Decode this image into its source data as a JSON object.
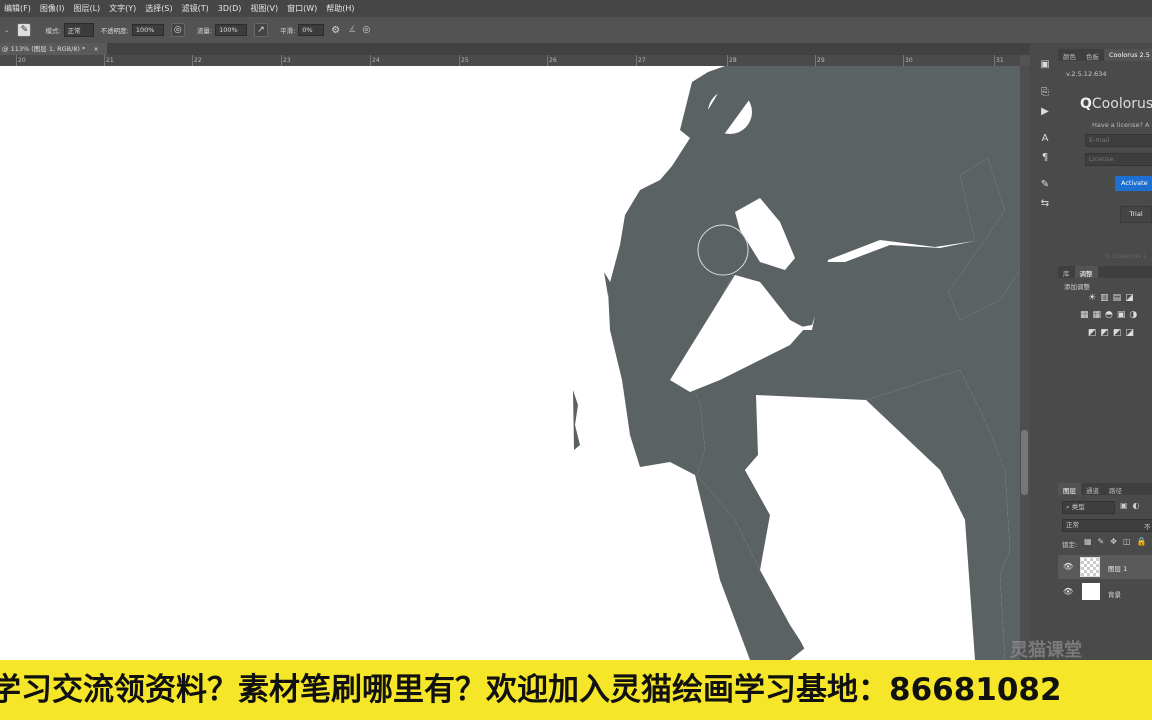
{
  "menu": [
    "编辑(F)",
    "图像(I)",
    "图层(L)",
    "文字(Y)",
    "选择(S)",
    "滤镜(T)",
    "3D(D)",
    "视图(V)",
    "窗口(W)",
    "帮助(H)"
  ],
  "options": {
    "mode_label": "模式:",
    "mode_value": "正常",
    "opacity_label": "不透明度:",
    "opacity_value": "100%",
    "flow_label": "流量:",
    "flow_value": "100%",
    "smoothing_label": "平滑:",
    "smoothing_value": "0%"
  },
  "document_tab": "@ 113% (图层 1, RGB/8) *",
  "ruler_labels": [
    "20",
    "21",
    "22",
    "23",
    "24",
    "25",
    "26",
    "27",
    "28",
    "29",
    "30",
    "31"
  ],
  "coolorus": {
    "tabs": [
      "颜色",
      "色板",
      "Coolorus 2.5"
    ],
    "version": "v.2.5.12.634",
    "logo": "Coolorus",
    "license_question": "Have a license? A",
    "email_placeholder": "E-mail",
    "license_placeholder": "License",
    "activate": "Activate",
    "trial": "Trial",
    "copyright": "© Coolorus L"
  },
  "adjustments": {
    "tabs": [
      "库",
      "调整"
    ],
    "title": "添加调整"
  },
  "layers": {
    "tabs": [
      "图层",
      "通道",
      "路径"
    ],
    "filter": "类型",
    "blend": "正常",
    "opacity_label": "不",
    "lock_label": "锁定:",
    "items": [
      {
        "name": "图层 1"
      },
      {
        "name": "背景"
      }
    ]
  },
  "caption": "学习交流领资料？素材笔刷哪里有？欢迎加入灵猫绘画学习基地：86681082",
  "watermark": "灵猫课堂",
  "colors": {
    "silhouette": "#5b6264",
    "caption_bg": "#f5e62a",
    "activate": "#1d6fd1"
  }
}
